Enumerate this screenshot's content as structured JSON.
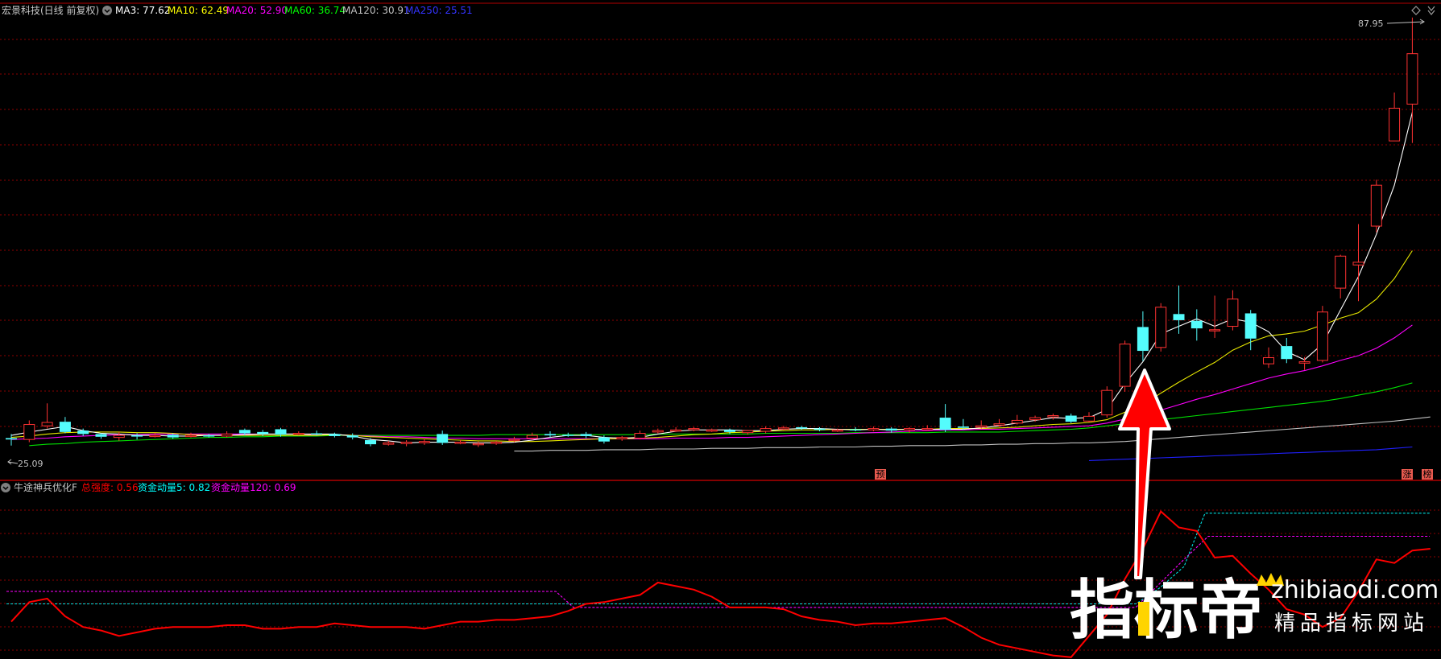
{
  "header": {
    "stock_title": "宏景科技(日线 前复权)",
    "ma_items": [
      {
        "label": "MA3: 77.62",
        "color": "#FFFFFF"
      },
      {
        "label": "MA10: 62.49",
        "color": "#FFFF00"
      },
      {
        "label": "MA20: 52.90",
        "color": "#FF00FF"
      },
      {
        "label": "MA60: 36.74",
        "color": "#00FF00"
      },
      {
        "label": "MA120: 30.91",
        "color": "#C0C0C0"
      },
      {
        "label": "MA250: 25.51",
        "color": "#0000FF"
      }
    ]
  },
  "indicator_header": {
    "title": "牛途神兵优化F",
    "items": [
      {
        "label": "总强度: 0.56",
        "color": "#FF0000"
      },
      {
        "label": "资金动量5: 0.82",
        "color": "#00FFFF"
      },
      {
        "label": "资金动量120: 0.69",
        "color": "#FF00FF"
      }
    ]
  },
  "price_labels": {
    "high": "87.95",
    "low": "25.09"
  },
  "markers": {
    "yu": "预",
    "zhang": "涨",
    "bang": "榜"
  },
  "watermark": {
    "brand": "指标帝",
    "domain": "zhibiaodi.com",
    "slogan": "精品指标网站"
  },
  "colors": {
    "up": "#FF3232",
    "down": "#54FCFC",
    "grid": "#8B0000",
    "border": "#B00000",
    "arrow": "#FF0000"
  },
  "chart_data": {
    "type": "candlestick",
    "price_ylim": [
      20,
      90
    ],
    "indicator_ylim": [
      0,
      1
    ],
    "candles": [
      [
        26.2,
        26.0,
        26.8,
        25.1
      ],
      [
        26.0,
        28.2,
        28.8,
        25.6
      ],
      [
        28.0,
        28.5,
        31.3,
        27.6
      ],
      [
        28.6,
        27.1,
        29.3,
        26.9
      ],
      [
        27.3,
        26.8,
        27.6,
        26.5
      ],
      [
        26.8,
        26.4,
        26.9,
        26.1
      ],
      [
        26.3,
        26.6,
        27.1,
        25.8
      ],
      [
        26.6,
        26.5,
        26.9,
        26.0
      ],
      [
        26.5,
        26.6,
        27.0,
        26.3
      ],
      [
        26.7,
        26.3,
        26.9,
        26.1
      ],
      [
        26.5,
        26.6,
        27.0,
        26.3
      ],
      [
        26.6,
        26.5,
        26.8,
        26.3
      ],
      [
        26.5,
        26.8,
        27.2,
        26.3
      ],
      [
        27.4,
        26.9,
        27.6,
        26.6
      ],
      [
        27.1,
        26.8,
        27.4,
        26.5
      ],
      [
        27.5,
        26.7,
        27.7,
        26.4
      ],
      [
        26.8,
        26.9,
        27.2,
        26.6
      ],
      [
        26.9,
        26.8,
        27.3,
        26.6
      ],
      [
        26.8,
        26.5,
        27.0,
        26.3
      ],
      [
        26.6,
        26.3,
        26.9,
        26.0
      ],
      [
        25.9,
        25.3,
        26.2,
        25.0
      ],
      [
        25.3,
        25.5,
        25.8,
        25.1
      ],
      [
        25.4,
        25.6,
        25.9,
        25.0
      ],
      [
        25.7,
        25.7,
        26.1,
        25.2
      ],
      [
        26.8,
        25.5,
        27.3,
        25.2
      ],
      [
        25.6,
        25.6,
        25.9,
        25.3
      ],
      [
        25.3,
        25.4,
        25.7,
        24.9
      ],
      [
        25.5,
        25.6,
        25.8,
        25.2
      ],
      [
        25.9,
        26.0,
        26.4,
        25.6
      ],
      [
        26.2,
        26.6,
        27.0,
        25.9
      ],
      [
        26.8,
        26.6,
        27.2,
        26.3
      ],
      [
        26.7,
        26.6,
        27.0,
        26.4
      ],
      [
        26.8,
        26.5,
        27.1,
        26.2
      ],
      [
        26.3,
        25.7,
        26.6,
        25.4
      ],
      [
        26.1,
        26.3,
        26.5,
        25.8
      ],
      [
        26.2,
        26.9,
        27.3,
        26.0
      ],
      [
        27.1,
        27.3,
        27.6,
        26.9
      ],
      [
        27.4,
        27.4,
        27.8,
        27.1
      ],
      [
        27.5,
        27.6,
        27.8,
        27.2
      ],
      [
        27.3,
        27.4,
        27.6,
        27.1
      ],
      [
        27.4,
        27.1,
        27.6,
        26.8
      ],
      [
        27.0,
        27.3,
        27.4,
        26.7
      ],
      [
        27.2,
        27.6,
        27.9,
        26.9
      ],
      [
        27.6,
        27.7,
        28.0,
        27.4
      ],
      [
        27.8,
        27.6,
        28.0,
        27.4
      ],
      [
        27.6,
        27.4,
        27.8,
        27.2
      ],
      [
        27.3,
        27.4,
        27.6,
        27.1
      ],
      [
        27.5,
        27.4,
        27.8,
        27.2
      ],
      [
        27.4,
        27.6,
        27.9,
        27.2
      ],
      [
        27.6,
        27.3,
        27.8,
        27.0
      ],
      [
        27.4,
        27.6,
        27.8,
        27.0
      ],
      [
        27.6,
        27.6,
        28.1,
        27.3
      ],
      [
        29.2,
        27.4,
        31.2,
        27.1
      ],
      [
        27.9,
        27.7,
        29.0,
        27.4
      ],
      [
        27.8,
        28.0,
        28.8,
        27.6
      ],
      [
        28.1,
        28.3,
        29.0,
        27.9
      ],
      [
        28.4,
        28.8,
        29.6,
        28.2
      ],
      [
        28.9,
        29.2,
        29.5,
        28.6
      ],
      [
        29.3,
        29.5,
        29.8,
        28.9
      ],
      [
        29.5,
        28.6,
        29.8,
        28.4
      ],
      [
        28.7,
        29.4,
        30.0,
        28.5
      ],
      [
        29.6,
        33.2,
        33.8,
        29.2
      ],
      [
        33.8,
        40.0,
        40.5,
        33.0
      ],
      [
        42.5,
        39.0,
        44.8,
        37.5
      ],
      [
        39.5,
        45.4,
        46.0,
        38.9
      ],
      [
        44.4,
        43.5,
        48.6,
        41.5
      ],
      [
        43.4,
        42.3,
        45.1,
        40.5
      ],
      [
        42.0,
        42.1,
        47.1,
        40.9
      ],
      [
        42.6,
        46.6,
        47.9,
        42.0
      ],
      [
        44.5,
        40.8,
        45.0,
        39.1
      ],
      [
        37.1,
        38.0,
        39.5,
        36.5
      ],
      [
        39.7,
        37.8,
        40.9,
        37.2
      ],
      [
        37.2,
        37.4,
        38.1,
        36.2
      ],
      [
        37.6,
        44.7,
        45.6,
        37.3
      ],
      [
        48.2,
        52.9,
        53.1,
        46.7
      ],
      [
        51.6,
        52.0,
        57.6,
        46.3
      ],
      [
        57.3,
        63.3,
        64.1,
        56.4
      ],
      [
        69.8,
        74.6,
        76.9,
        69.8
      ],
      [
        75.2,
        82.6,
        87.9,
        69.5
      ]
    ],
    "ma3": [
      26.6,
      27.1,
      27.5,
      27.9,
      27.3,
      26.9,
      26.8,
      26.6,
      26.6,
      26.5,
      26.5,
      26.6,
      26.6,
      26.7,
      26.8,
      26.8,
      26.8,
      26.8,
      26.8,
      26.5,
      26.0,
      25.8,
      25.5,
      25.6,
      25.6,
      25.6,
      25.5,
      25.5,
      25.6,
      25.9,
      26.3,
      26.6,
      26.6,
      26.3,
      26.2,
      26.3,
      26.8,
      27.2,
      27.4,
      27.4,
      27.4,
      27.3,
      27.3,
      27.5,
      27.6,
      27.6,
      27.5,
      27.4,
      27.5,
      27.4,
      27.5,
      27.5,
      27.5,
      27.5,
      27.7,
      28.0,
      28.4,
      28.8,
      29.2,
      29.1,
      29.2,
      30.4,
      34.2,
      37.4,
      41.5,
      42.6,
      43.7,
      42.6,
      43.7,
      43.2,
      41.8,
      38.9,
      37.7,
      40.0,
      45.0,
      49.9,
      56.1,
      63.3,
      74.0
    ],
    "ma10": [
      26.3,
      26.5,
      26.8,
      27.0,
      27.1,
      27.1,
      27.1,
      27.0,
      27.0,
      26.9,
      26.7,
      26.6,
      26.6,
      26.6,
      26.6,
      26.6,
      26.6,
      26.6,
      26.7,
      26.6,
      26.4,
      26.3,
      26.2,
      26.1,
      26.0,
      25.9,
      25.8,
      25.8,
      25.7,
      25.7,
      25.8,
      25.9,
      26.0,
      26.1,
      26.1,
      26.2,
      26.3,
      26.5,
      26.7,
      26.8,
      27.0,
      27.1,
      27.2,
      27.3,
      27.4,
      27.4,
      27.5,
      27.5,
      27.5,
      27.5,
      27.5,
      27.5,
      27.6,
      27.6,
      27.6,
      27.7,
      27.8,
      28.0,
      28.2,
      28.3,
      28.5,
      28.9,
      30.0,
      31.1,
      32.8,
      34.4,
      35.9,
      37.3,
      39.1,
      40.3,
      41.2,
      41.5,
      41.9,
      42.8,
      43.8,
      44.6,
      46.6,
      49.6,
      53.7
    ],
    "ma20": [
      26.0,
      26.1,
      26.2,
      26.4,
      26.5,
      26.6,
      26.7,
      26.7,
      26.8,
      26.8,
      26.8,
      26.8,
      26.8,
      26.8,
      26.8,
      26.8,
      26.8,
      26.7,
      26.7,
      26.6,
      26.5,
      26.4,
      26.4,
      26.3,
      26.2,
      26.2,
      26.1,
      26.1,
      26.1,
      26.1,
      26.1,
      26.1,
      26.1,
      26.1,
      26.1,
      26.1,
      26.1,
      26.2,
      26.2,
      26.2,
      26.3,
      26.3,
      26.4,
      26.5,
      26.6,
      26.7,
      26.8,
      26.9,
      27.0,
      27.1,
      27.2,
      27.3,
      27.4,
      27.4,
      27.5,
      27.5,
      27.6,
      27.7,
      27.8,
      27.9,
      28.0,
      28.4,
      29.0,
      29.6,
      30.3,
      31.1,
      31.9,
      32.6,
      33.4,
      34.2,
      35.0,
      35.6,
      36.1,
      36.8,
      37.6,
      38.3,
      39.4,
      40.9,
      42.8
    ],
    "ma60_start": 1,
    "ma60": [
      25.1,
      25.3,
      25.4,
      25.6,
      25.7,
      25.8,
      25.9,
      26.0,
      26.1,
      26.2,
      26.3,
      26.3,
      26.4,
      26.4,
      26.5,
      26.5,
      26.5,
      26.6,
      26.6,
      26.6,
      26.6,
      26.6,
      26.6,
      26.6,
      26.6,
      26.6,
      26.7,
      26.7,
      26.7,
      26.7,
      26.7,
      26.7,
      26.7,
      26.7,
      26.7,
      26.8,
      26.8,
      26.8,
      26.8,
      26.8,
      26.8,
      26.9,
      26.9,
      26.9,
      26.9,
      26.9,
      27.0,
      27.0,
      27.0,
      27.0,
      27.0,
      27.1,
      27.1,
      27.1,
      27.1,
      27.2,
      27.3,
      27.4,
      27.5,
      27.7,
      28.0,
      28.3,
      28.6,
      28.9,
      29.2,
      29.5,
      29.8,
      30.1,
      30.4,
      30.7,
      31.0,
      31.3,
      31.6,
      32.0,
      32.5,
      33.0,
      33.6,
      34.3
    ],
    "ma120_start": 28,
    "ma120": [
      24.3,
      24.3,
      24.4,
      24.4,
      24.4,
      24.5,
      24.5,
      24.5,
      24.6,
      24.6,
      24.6,
      24.7,
      24.7,
      24.7,
      24.8,
      24.8,
      24.8,
      24.9,
      24.9,
      24.9,
      25.0,
      25.0,
      25.1,
      25.1,
      25.1,
      25.2,
      25.2,
      25.3,
      25.3,
      25.4,
      25.4,
      25.5,
      25.5,
      25.6,
      25.7,
      25.9,
      26.1,
      26.3,
      26.5,
      26.7,
      26.9,
      27.1,
      27.3,
      27.5,
      27.7,
      27.9,
      28.1,
      28.3,
      28.5,
      28.7,
      29.0,
      29.3
    ],
    "ma250_start": 60,
    "ma250": [
      22.9,
      23.0,
      23.1,
      23.2,
      23.3,
      23.4,
      23.5,
      23.6,
      23.7,
      23.8,
      23.9,
      24.0,
      24.1,
      24.2,
      24.3,
      24.4,
      24.5,
      24.7,
      24.9
    ],
    "strength": [
      0.21,
      0.32,
      0.34,
      0.24,
      0.18,
      0.16,
      0.13,
      0.15,
      0.17,
      0.18,
      0.18,
      0.18,
      0.19,
      0.19,
      0.17,
      0.17,
      0.18,
      0.18,
      0.2,
      0.19,
      0.18,
      0.18,
      0.18,
      0.17,
      0.19,
      0.21,
      0.21,
      0.22,
      0.22,
      0.23,
      0.24,
      0.27,
      0.31,
      0.32,
      0.34,
      0.36,
      0.43,
      0.41,
      0.39,
      0.35,
      0.29,
      0.29,
      0.29,
      0.28,
      0.24,
      0.22,
      0.21,
      0.19,
      0.2,
      0.2,
      0.21,
      0.22,
      0.23,
      0.18,
      0.12,
      0.08,
      0.06,
      0.04,
      0.02,
      0.01,
      0.13,
      0.25,
      0.45,
      0.62,
      0.83,
      0.74,
      0.72,
      0.57,
      0.58,
      0.48,
      0.39,
      0.28,
      0.25,
      0.18,
      0.23,
      0.38,
      0.56,
      0.54,
      0.61,
      0.62
    ],
    "fund5_val": 0.82,
    "fund120_val": 0.69
  }
}
